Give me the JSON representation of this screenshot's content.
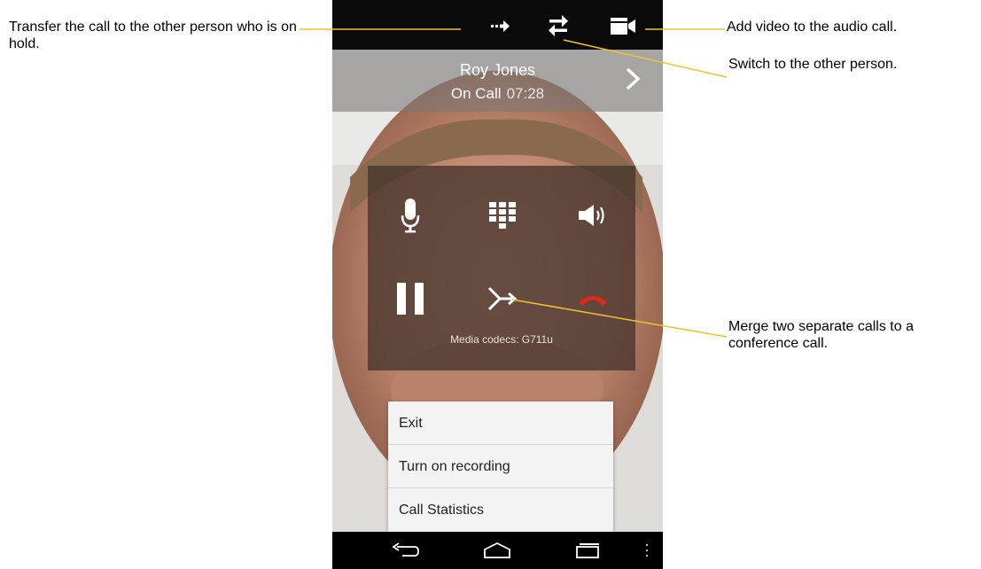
{
  "annotations": {
    "transfer": "Transfer the call to the other person who is on hold.",
    "add_video": "Add video to the audio call.",
    "switch": "Switch to the other person.",
    "merge": "Merge two separate calls to a conference call."
  },
  "call": {
    "name": "Roy Jones",
    "status_label": "On Call",
    "duration": "07:28",
    "codecs": "Media codecs: G711u"
  },
  "menu": {
    "items": [
      "Exit",
      "Turn on recording",
      "Call Statistics"
    ]
  },
  "colors": {
    "callout_line": "#f5c12e",
    "end_call_red": "#e0281e",
    "topbar_bg": "#0a0a0a"
  },
  "icons": {
    "topbar": [
      "transfer-icon",
      "switch-icon",
      "video-icon"
    ],
    "controls": [
      "microphone-icon",
      "keypad-icon",
      "speaker-icon",
      "pause-icon",
      "merge-icon",
      "end-call-icon"
    ],
    "nav": [
      "back-icon",
      "home-icon",
      "recent-apps-icon",
      "more-icon"
    ]
  }
}
